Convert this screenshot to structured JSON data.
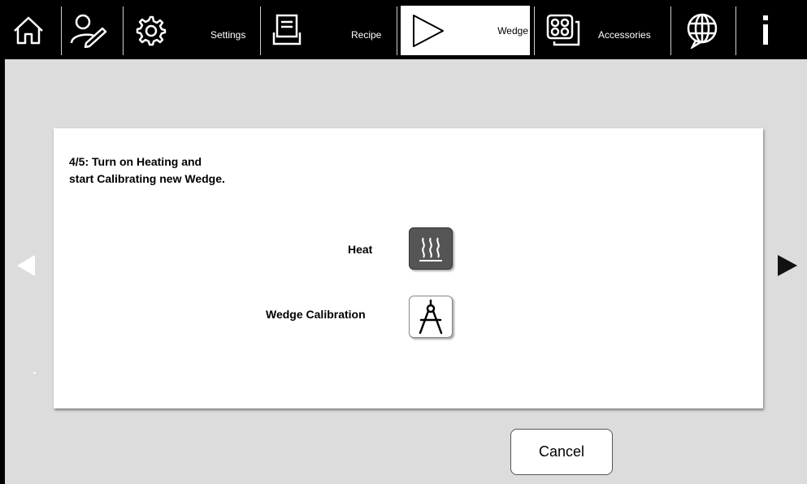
{
  "topbar": {
    "items": [
      {
        "name": "home",
        "icon": "home-icon"
      },
      {
        "name": "user-edit",
        "icon": "user-edit-icon"
      },
      {
        "name": "settings",
        "icon": "gear-icon",
        "label": "Settings"
      },
      {
        "name": "recipe",
        "icon": "recipe-icon",
        "label": "Recipe"
      },
      {
        "name": "wedge",
        "icon": "wedge-icon",
        "label": "Wedge",
        "active": true
      },
      {
        "name": "accessories",
        "icon": "accessories-icon",
        "label": "Accessories"
      },
      {
        "name": "language",
        "icon": "globe-icon"
      },
      {
        "name": "info",
        "icon": "info-icon"
      }
    ]
  },
  "dialog": {
    "instruction_line1": "4/5: Turn on Heating and",
    "instruction_line2": "start Calibrating new Wedge.",
    "heat_label": "Heat",
    "calibration_label": "Wedge Calibration"
  },
  "footer": {
    "cancel_label": "Cancel"
  },
  "colors": {
    "topbar_bg": "#000000",
    "page_bg": "#dcdcdc",
    "heat_button_bg": "#555555"
  }
}
